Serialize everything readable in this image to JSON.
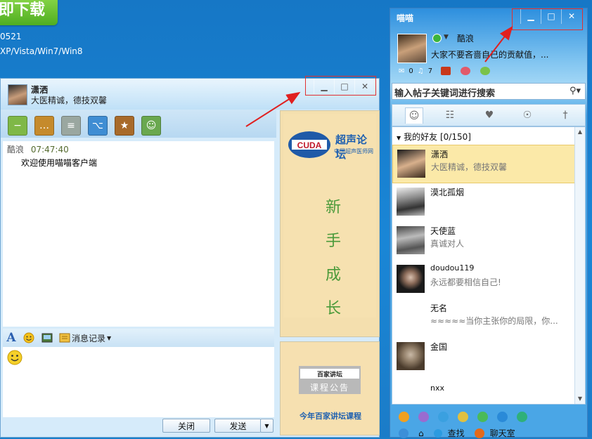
{
  "background": {
    "download_button": "即下载",
    "line1": "0521",
    "line2": "XP/Vista/Win7/Win8"
  },
  "chat": {
    "contact_name": "潇洒",
    "contact_signature": "大医精诚，德技双馨",
    "toolbar_icons": [
      "minus-icon",
      "chat-bubble-icon",
      "note-icon",
      "share-icon",
      "star-icon",
      "robot-icon"
    ],
    "message": {
      "sender": "酷浪",
      "time": "07:47:40",
      "text": "欢迎使用喵喵客户端"
    },
    "format_bar": {
      "history_label": "消息记录"
    },
    "buttons": {
      "close": "关闭",
      "send": "发送"
    }
  },
  "ads": {
    "forum_logo": "CUDA",
    "forum_title": "超声论坛",
    "forum_subtitle": "中国超声医师网",
    "vertical_text": [
      "新",
      "手",
      "成",
      "长"
    ],
    "lecture_logo": "百家讲坛",
    "lecture_banner": "课程公告",
    "lecture_caption": "今年百家讲坛课程"
  },
  "buddy": {
    "app_title": "喵喵",
    "self_nick": "酷浪",
    "self_signature": "大家不要吝啬自己的贡献值，...",
    "counts": {
      "mail": "0",
      "sound": "7"
    },
    "search_placeholder": "输入帖子关键词进行搜索",
    "group_label": "我的好友 [0/150]",
    "friends": [
      {
        "name": "潇洒",
        "signature": "大医精诚，德技双馨"
      },
      {
        "name": "漠北孤烟",
        "signature": ""
      },
      {
        "name": "天使蓝",
        "signature": "真诚对人"
      },
      {
        "name": "doudou119",
        "signature": "永远都要相信自己!"
      },
      {
        "name": "无名",
        "signature": "≈≈≈≈≈当你主张你的局限，你..."
      },
      {
        "name": "金国",
        "signature": ""
      },
      {
        "name": "nxx",
        "signature": ""
      }
    ],
    "bottom": {
      "find": "查找",
      "chatroom": "聊天室"
    }
  },
  "colors": {
    "accent": "#1a86d6",
    "highlight_box": "#e03030",
    "selected_row": "#fbe9a8"
  }
}
